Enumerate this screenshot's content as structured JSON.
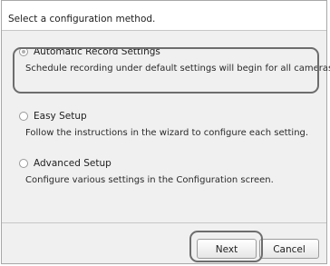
{
  "header": {
    "instruction": "Select a configuration method."
  },
  "options": [
    {
      "label": "Automatic Record Settings",
      "description": "Schedule recording under default settings will begin for all cameras.",
      "selected": true
    },
    {
      "label": "Easy Setup",
      "description": "Follow the instructions in the wizard to configure each setting.",
      "selected": false
    },
    {
      "label": "Advanced Setup",
      "description": "Configure various settings in the Configuration screen.",
      "selected": false
    }
  ],
  "footer": {
    "next_label": "Next",
    "cancel_label": "Cancel"
  },
  "colors": {
    "panel_background": "#f0f0f0",
    "highlight_frame": "#6d6d6d"
  }
}
